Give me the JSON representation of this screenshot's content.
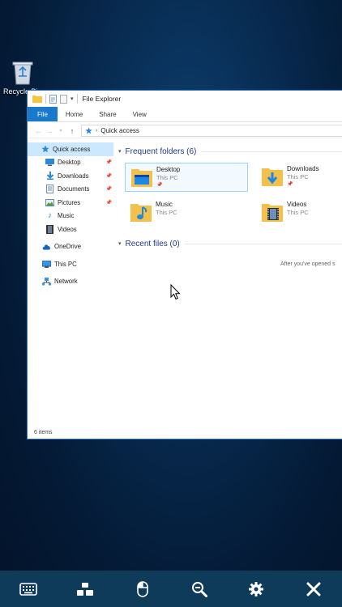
{
  "desktop": {
    "recycle_bin_label": "Recycle Bin"
  },
  "window": {
    "title": "File Explorer",
    "ribbon_tabs": [
      "File",
      "Home",
      "Share",
      "View"
    ],
    "address": {
      "location": "Quick access"
    },
    "status": "6 items"
  },
  "navpane": {
    "items": [
      {
        "label": "Quick access",
        "icon": "star-icon"
      },
      {
        "label": "Desktop",
        "icon": "desktop-icon",
        "pinned": true
      },
      {
        "label": "Downloads",
        "icon": "download-icon",
        "pinned": true
      },
      {
        "label": "Documents",
        "icon": "documents-icon",
        "pinned": true
      },
      {
        "label": "Pictures",
        "icon": "pictures-icon",
        "pinned": true
      },
      {
        "label": "Music",
        "icon": "music-icon"
      },
      {
        "label": "Videos",
        "icon": "videos-icon"
      },
      {
        "label": "OneDrive",
        "icon": "cloud-icon"
      },
      {
        "label": "This PC",
        "icon": "computer-icon"
      },
      {
        "label": "Network",
        "icon": "network-icon"
      }
    ]
  },
  "content": {
    "frequent_header": "Frequent folders (6)",
    "recent_header": "Recent files (0)",
    "empty_hint": "After you've opened s",
    "folders": [
      {
        "name": "Desktop",
        "location": "This PC",
        "pinned": true,
        "icon": "desktop-folder-icon"
      },
      {
        "name": "Downloads",
        "location": "This PC",
        "pinned": true,
        "icon": "downloads-folder-icon"
      },
      {
        "name": "Music",
        "location": "This PC",
        "pinned": false,
        "icon": "music-folder-icon"
      },
      {
        "name": "Videos",
        "location": "This PC",
        "pinned": false,
        "icon": "videos-folder-icon"
      }
    ]
  },
  "toolbar": {
    "buttons": [
      "keyboard-icon",
      "windows-switch-icon",
      "mouse-icon",
      "zoom-icon",
      "settings-icon",
      "close-icon"
    ]
  },
  "colors": {
    "accent": "#1979ca",
    "toolbar_bg": "#0e3b5a",
    "selection": "#cce8ff"
  }
}
